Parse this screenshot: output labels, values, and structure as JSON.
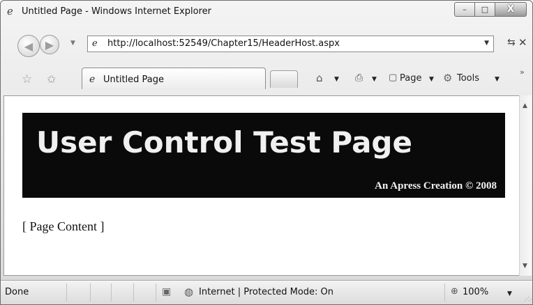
{
  "window": {
    "title": "Untitled Page - Windows Internet Explorer",
    "buttons": {
      "minimize": "–",
      "maximize": "□",
      "close": "X"
    }
  },
  "navigation": {
    "back_icon": "back-arrow-icon",
    "forward_icon": "forward-arrow-icon",
    "url": "http://localhost:52549/Chapter15/HeaderHost.aspx",
    "refresh_icon": "refresh-icon",
    "stop_icon": "stop-icon"
  },
  "tabs": [
    {
      "label": "Untitled Page",
      "active": true
    }
  ],
  "commands": {
    "page": "Page",
    "tools": "Tools"
  },
  "page": {
    "banner_title": "User Control Test Page",
    "banner_subtitle": "An Apress Creation © 2008",
    "content": "[ Page Content ]",
    "banner_color": "#0a0a0a"
  },
  "status": {
    "text": "Done",
    "zone": "Internet | Protected Mode: On",
    "zoom": "100%"
  }
}
